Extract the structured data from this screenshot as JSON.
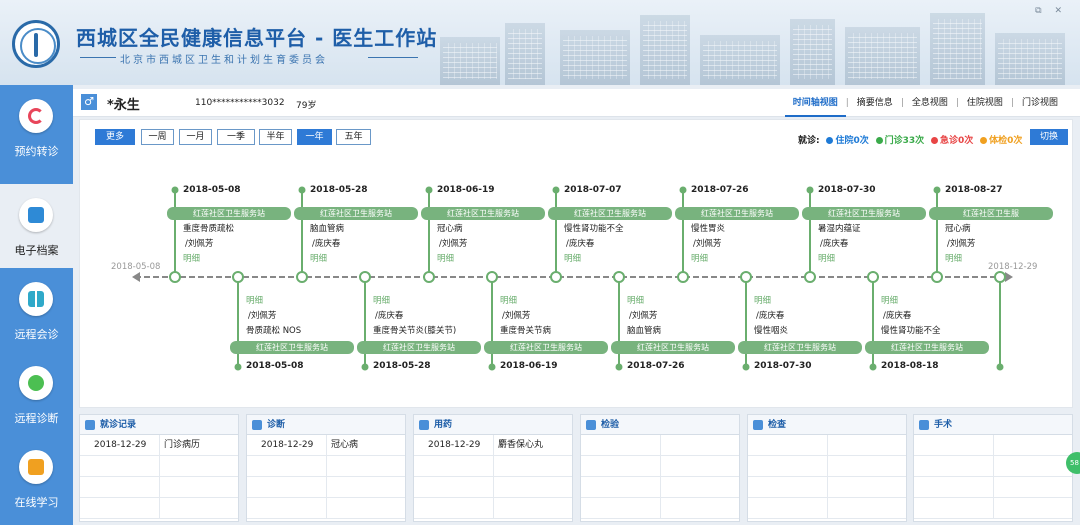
{
  "header": {
    "title": "西城区全民健康信息平台 - 医生工作站",
    "subtitle": "北京市西城区卫生和计划生育委员会"
  },
  "sidebar": {
    "items": [
      {
        "label": "预约转诊",
        "icon": "refresh-icon",
        "color": "#e8455a"
      },
      {
        "label": "电子档案",
        "icon": "document-icon",
        "color": "#2e8ad6",
        "active": true
      },
      {
        "label": "远程会诊",
        "icon": "grid-icon",
        "color": "#2fa9c9"
      },
      {
        "label": "远程诊断",
        "icon": "diagnosis-icon",
        "color": "#4cbf52"
      },
      {
        "label": "在线学习",
        "icon": "learning-icon",
        "color": "#f0a020"
      }
    ]
  },
  "patient": {
    "gender": "♂",
    "name": "*永生",
    "id": "110***********3032",
    "age": "79岁"
  },
  "view_tabs": [
    "时间轴视图",
    "摘要信息",
    "全息视图",
    "住院视图",
    "门诊视图"
  ],
  "range_buttons": [
    "更多",
    "一周",
    "一月",
    "一季",
    "半年",
    "一年",
    "五年"
  ],
  "summary": {
    "label": "就诊:",
    "items": [
      {
        "text": "住院0次",
        "color": "#1e7ad6"
      },
      {
        "text": "门诊33次",
        "color": "#3aaa4a"
      },
      {
        "text": "急诊0次",
        "color": "#e84545"
      },
      {
        "text": "体检0次",
        "color": "#f0a020"
      }
    ]
  },
  "switch_label": "切换",
  "timeline": {
    "start_date": "2018-05-08",
    "end_date": "2018-12-29",
    "upper": [
      {
        "date": "2018-05-08",
        "org": "红莲社区卫生服务站",
        "diagnosis": "重度骨质疏松",
        "doctor": "/刘佩芳",
        "link": "明细"
      },
      {
        "date": "2018-05-28",
        "org": "红莲社区卫生服务站",
        "diagnosis": "脑血管病",
        "doctor": "/庞庆春",
        "link": "明细"
      },
      {
        "date": "2018-06-19",
        "org": "红莲社区卫生服务站",
        "diagnosis": "冠心病",
        "doctor": "/刘佩芳",
        "link": "明细"
      },
      {
        "date": "2018-07-07",
        "org": "红莲社区卫生服务站",
        "diagnosis": "慢性肾功能不全",
        "doctor": "/庞庆春",
        "link": "明细"
      },
      {
        "date": "2018-07-26",
        "org": "红莲社区卫生服务站",
        "diagnosis": "慢性胃炎",
        "doctor": "/刘佩芳",
        "link": "明细"
      },
      {
        "date": "2018-07-30",
        "org": "红莲社区卫生服务站",
        "diagnosis": "暑湿内蕴证",
        "doctor": "/庞庆春",
        "link": "明细"
      },
      {
        "date": "2018-08-27",
        "org": "红莲社区卫生服",
        "diagnosis": "冠心病",
        "doctor": "/刘佩芳",
        "link": "明细"
      }
    ],
    "lower": [
      {
        "date": "2018-05-08",
        "org": "红莲社区卫生服务站",
        "diagnosis": "骨质疏松 NOS",
        "doctor": "/刘佩芳",
        "link": "明细"
      },
      {
        "date": "2018-05-28",
        "org": "红莲社区卫生服务站",
        "diagnosis": "重度骨关节炎(膝关节)",
        "doctor": "/庞庆春",
        "link": "明细"
      },
      {
        "date": "2018-06-19",
        "org": "红莲社区卫生服务站",
        "diagnosis": "重度骨关节病",
        "doctor": "/刘佩芳",
        "link": "明细"
      },
      {
        "date": "2018-07-26",
        "org": "红莲社区卫生服务站",
        "diagnosis": "脑血管病",
        "doctor": "/刘佩芳",
        "link": "明细"
      },
      {
        "date": "2018-07-30",
        "org": "红莲社区卫生服务站",
        "diagnosis": "慢性咽炎",
        "doctor": "/庞庆春",
        "link": "明细"
      },
      {
        "date": "2018-08-18",
        "org": "红莲社区卫生服务站",
        "diagnosis": "慢性肾功能不全",
        "doctor": "/庞庆春",
        "link": "明细"
      }
    ]
  },
  "panels": [
    {
      "title": "就诊记录",
      "icon": "record-icon",
      "rows": [
        [
          "2018-12-29",
          "门诊病历"
        ],
        [
          "",
          ""
        ],
        [
          "",
          ""
        ],
        [
          "",
          ""
        ]
      ]
    },
    {
      "title": "诊断",
      "icon": "diagnosis-icon",
      "rows": [
        [
          "2018-12-29",
          "冠心病"
        ],
        [
          "",
          ""
        ],
        [
          "",
          ""
        ],
        [
          "",
          ""
        ]
      ]
    },
    {
      "title": "用药",
      "icon": "medicine-icon",
      "rows": [
        [
          "2018-12-29",
          "麝香保心丸"
        ],
        [
          "",
          ""
        ],
        [
          "",
          ""
        ],
        [
          "",
          ""
        ]
      ]
    },
    {
      "title": "检验",
      "icon": "lab-icon",
      "rows": [
        [
          "",
          ""
        ],
        [
          "",
          ""
        ],
        [
          "",
          ""
        ],
        [
          "",
          ""
        ]
      ]
    },
    {
      "title": "检查",
      "icon": "exam-icon",
      "rows": [
        [
          "",
          ""
        ],
        [
          "",
          ""
        ],
        [
          "",
          ""
        ],
        [
          "",
          ""
        ]
      ]
    },
    {
      "title": "手术",
      "icon": "surgery-icon",
      "rows": [
        [
          "",
          ""
        ],
        [
          "",
          ""
        ],
        [
          "",
          ""
        ],
        [
          "",
          ""
        ]
      ]
    }
  ],
  "float_button": "58"
}
